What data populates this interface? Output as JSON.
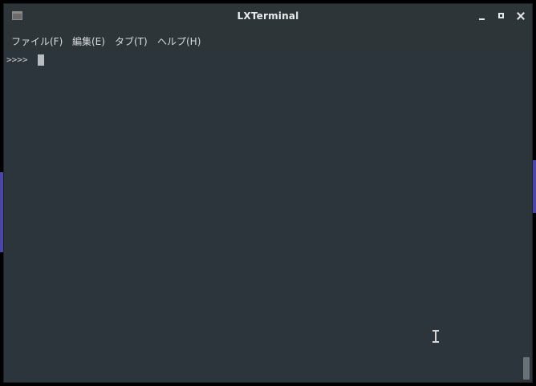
{
  "window": {
    "title": "LXTerminal",
    "app_icon": "terminal-icon",
    "controls": {
      "minimize_icon": "minimize-icon",
      "maximize_icon": "maximize-icon",
      "close_icon": "close-icon"
    }
  },
  "menubar": {
    "items": [
      {
        "label": "ファイル(F)"
      },
      {
        "label": "編集(E)"
      },
      {
        "label": "タブ(T)"
      },
      {
        "label": "ヘルプ(H)"
      }
    ]
  },
  "terminal": {
    "prompt": ">>>>",
    "input": "",
    "scroll_position": 1.0
  },
  "colors": {
    "background": "#2c353b",
    "titlebar": "#2e3539",
    "text": "#d9dde0",
    "wallpaper_accent": "#4b45a8"
  }
}
